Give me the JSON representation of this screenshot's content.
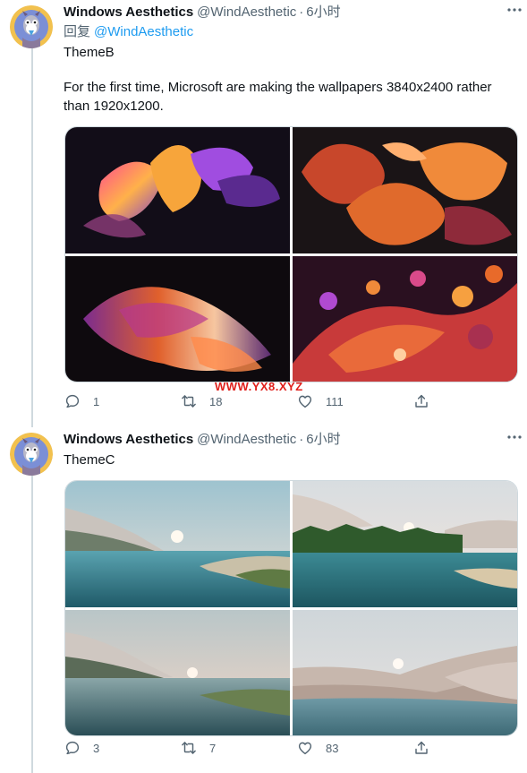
{
  "tweets": [
    {
      "author_name": "Windows Aesthetics",
      "author_handle": "@WindAesthetic",
      "separator": "·",
      "time": "6小时",
      "reply_prefix": "回复",
      "reply_to": "@WindAesthetic",
      "text_line1": "ThemeB",
      "text_line2": "For the first time, Microsoft are making the wallpapers 3840x2400 rather than 1920x1200.",
      "replies": "1",
      "retweets": "18",
      "likes": "111"
    },
    {
      "author_name": "Windows Aesthetics",
      "author_handle": "@WindAesthetic",
      "separator": "·",
      "time": "6小时",
      "text_line1": "ThemeC",
      "replies": "3",
      "retweets": "7",
      "likes": "83"
    }
  ],
  "watermark": "WWW.YX8.XYZ",
  "icons": {
    "reply": "reply-icon",
    "retweet": "retweet-icon",
    "like": "heart-icon",
    "share": "share-icon",
    "more": "more-icon"
  },
  "colors": {
    "accent": "#1d9bf0",
    "muted": "#536471",
    "watermark": "#e0201c"
  }
}
